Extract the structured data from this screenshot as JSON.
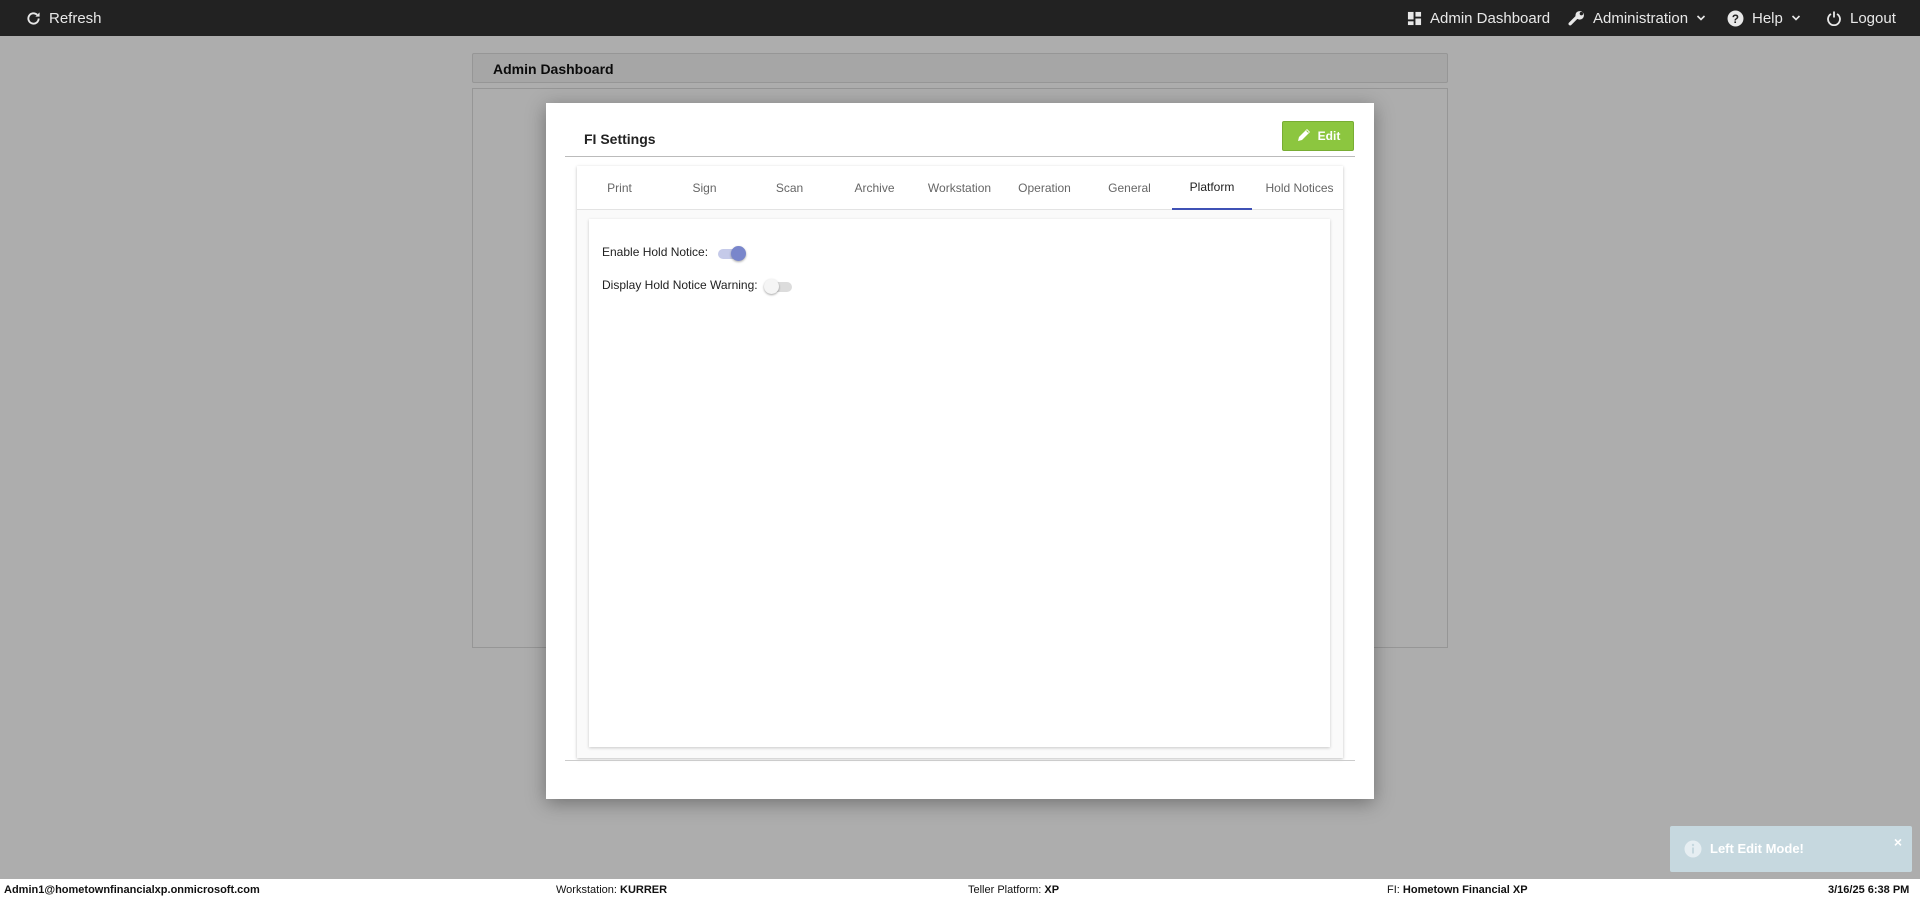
{
  "topbar": {
    "refresh_label": "Refresh",
    "admin_dashboard_label": "Admin Dashboard",
    "administration_label": "Administration",
    "help_label": "Help",
    "logout_label": "Logout",
    "icons": [
      "refresh-icon",
      "dashboard-icon",
      "wrench-icon",
      "help-icon",
      "power-icon",
      "chevron-down-icon"
    ]
  },
  "page": {
    "header_title": "Admin Dashboard"
  },
  "modal": {
    "title": "FI Settings",
    "edit_label": "Edit",
    "edit_color": "#8cc63f",
    "tabs": [
      "Print",
      "Sign",
      "Scan",
      "Archive",
      "Workstation",
      "Operation",
      "General",
      "Platform",
      "Hold Notices"
    ],
    "active_tab": "Platform",
    "settings": [
      {
        "label": "Enable Hold Notice:",
        "enabled": true
      },
      {
        "label": "Display Hold Notice Warning:",
        "enabled": false
      }
    ],
    "accent_color": "#3f51b5"
  },
  "toast": {
    "message": "Left Edit Mode!",
    "close": "×"
  },
  "statusbar": {
    "user": "Admin1@hometownfinancialxp.onmicrosoft.com",
    "workstation_label": "Workstation:",
    "workstation_value": "KURRER",
    "platform_label": "Teller Platform:",
    "platform_value": "XP",
    "fi_label": "FI:",
    "fi_value": "Hometown Financial XP",
    "datetime": "3/16/25 6:38 PM"
  }
}
